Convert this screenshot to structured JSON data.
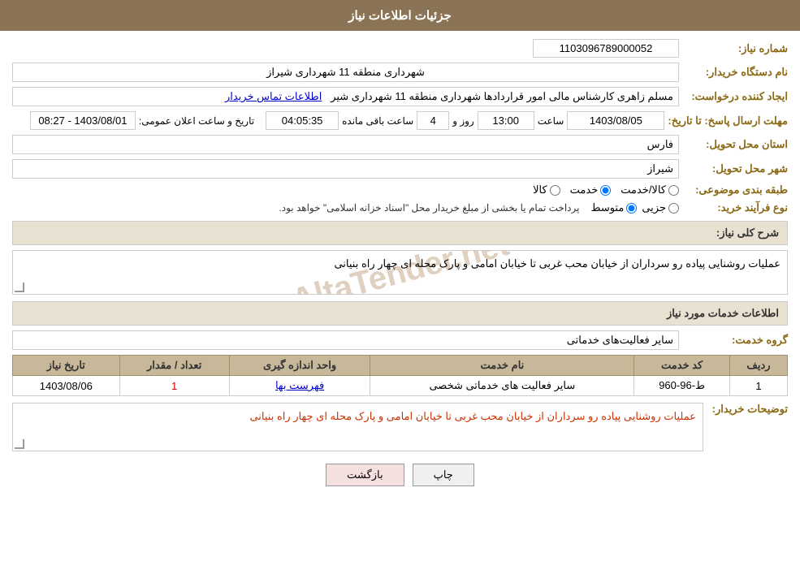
{
  "header": {
    "title": "جزئیات اطلاعات نیاز"
  },
  "fields": {
    "shomare_niaz_label": "شماره نیاز:",
    "shomare_niaz_value": "1103096789000052",
    "name_dastgah_label": "نام دستگاه خریدار:",
    "name_dastgah_value": "شهرداری منطقه 11 شهرداری شیراز",
    "ijad_label": "ایجاد کننده درخواست:",
    "ijad_value": "مسلم زاهری کارشناس مالی امور قراردادها شهرداری منطقه 11 شهرداری شیر",
    "ijad_link": "اطلاعات تماس خریدار",
    "mohlet_label": "مهلت ارسال پاسخ: تا تاریخ:",
    "date_value": "1403/08/05",
    "time_label": "ساعت",
    "time_value": "13:00",
    "days_label": "روز و",
    "days_value": "4",
    "remaining_label": "ساعت باقی مانده",
    "remaining_value": "04:05:35",
    "tarikh_label": "تاریخ و ساعت اعلان عمومی:",
    "tarikh_value": "1403/08/01 - 08:27",
    "ostan_label": "استان محل تحویل:",
    "ostan_value": "فارس",
    "shahr_label": "شهر محل تحویل:",
    "shahr_value": "شیراز",
    "tabaqe_label": "طبقه بندی موضوعی:",
    "tabaqe_options": [
      "کالا",
      "خدمت",
      "کالا/خدمت"
    ],
    "tabaqe_selected": "خدمت",
    "noefrayand_label": "نوع فرآیند خرید:",
    "noefrayand_options": [
      "جزیی",
      "متوسط"
    ],
    "noefrayand_selected": "متوسط",
    "noefrayand_text": "پرداخت تمام یا بخشی از مبلغ خریدار محل \"اسناد خزانه اسلامی\" خواهد بود.",
    "sharh_label": "شرح کلی نیاز:",
    "sharh_value": "عملیات روشنایی پیاده رو سرداران از خیابان محب غربی تا خیابان امامی و پارک محله ای چهار راه بنیانی",
    "services_section_title": "اطلاعات خدمات مورد نیاز",
    "grohe_label": "گروه خدمت:",
    "grohe_value": "سایر فعالیت‌های خدماتی",
    "table": {
      "headers": [
        "ردیف",
        "کد خدمت",
        "نام خدمت",
        "واحد اندازه گیری",
        "تعداد / مقدار",
        "تاریخ نیاز"
      ],
      "rows": [
        {
          "radif": "1",
          "code": "ط-96-960",
          "name": "سایر فعالیت های خدماتی شخصی",
          "vahed": "فهرست بها",
          "tedad": "1",
          "tarikh": "1403/08/06"
        }
      ]
    },
    "tozihat_label": "توضیحات خریدار:",
    "tozihat_value": "عملیات روشنایی پیاده رو سرداران از خیابان محب غربی تا خیابان امامی و پارک محله ای چهار راه بنیانی"
  },
  "buttons": {
    "print": "چاپ",
    "back": "بازگشت"
  }
}
